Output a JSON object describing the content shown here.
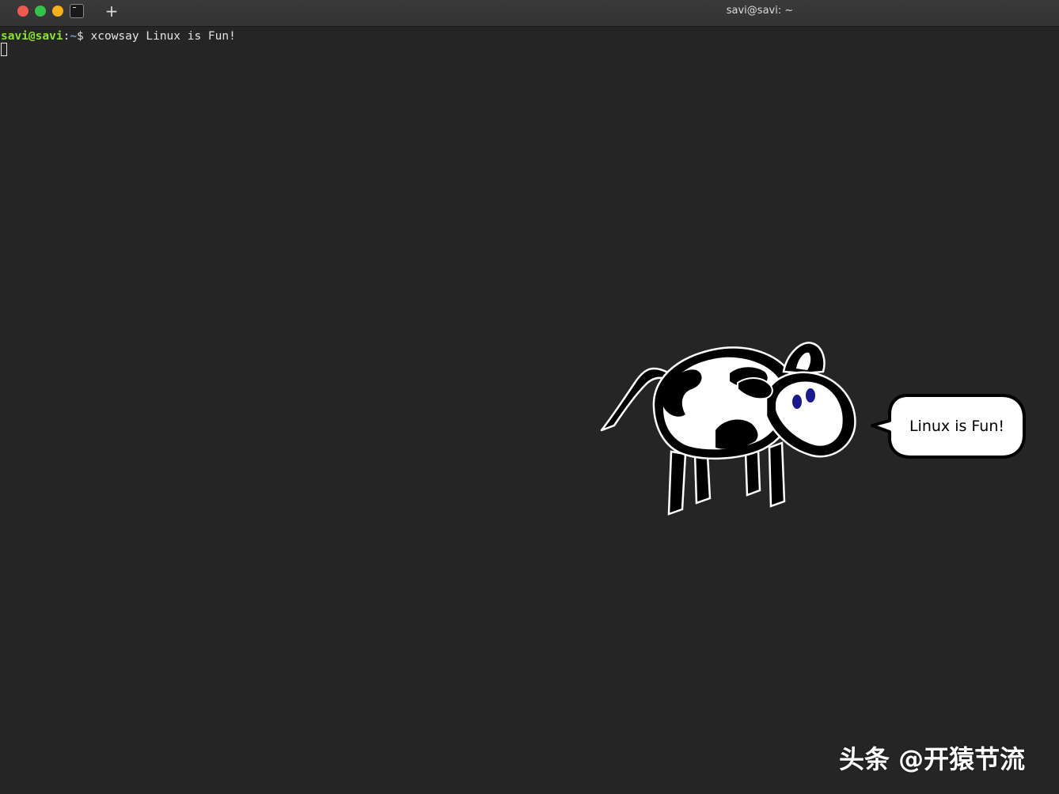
{
  "window": {
    "title": "savi@savi: ~",
    "new_tab_label": "+"
  },
  "terminal": {
    "prompt_user": "savi@savi",
    "prompt_sep": ":",
    "prompt_path": "~",
    "prompt_symbol": "$ ",
    "command": "xcowsay Linux is Fun!"
  },
  "cow": {
    "speech": "Linux is Fun!"
  },
  "watermark": {
    "text": "头条 @开猿节流"
  },
  "colors": {
    "background": "#252525",
    "prompt_user": "#8ae234",
    "prompt_path": "#729fcf",
    "close": "#ee5a52",
    "minimize": "#36c249",
    "maximize": "#f5b11a",
    "cow_eyes": "#1a1a8c"
  },
  "icons": [
    "close-icon",
    "minimize-icon",
    "maximize-icon",
    "terminal-icon",
    "plus-icon"
  ]
}
